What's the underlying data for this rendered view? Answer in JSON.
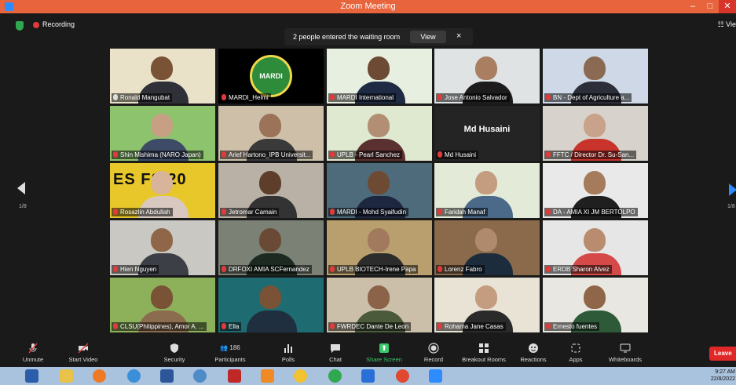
{
  "window": {
    "title": "Zoom Meeting"
  },
  "topbar": {
    "recording_label": "Recording",
    "view_label": "Vie"
  },
  "notification": {
    "text": "2 people entered the waiting room",
    "view_label": "View",
    "close_glyph": "×"
  },
  "pagination": {
    "left": "1/8",
    "right": "1/8"
  },
  "participants": [
    {
      "name": "Ronald Mangubat",
      "muted": false,
      "active": true,
      "tile_bg": "#e9e2c8",
      "skin": "#7a5236",
      "shirt": "#2f3038"
    },
    {
      "name": "MARDI_Helmi",
      "muted": true,
      "logo": "MARDI",
      "tile_bg": "#000000"
    },
    {
      "name": "MARDI International",
      "muted": true,
      "tile_bg": "#e6efe0",
      "skin": "#6d4a34",
      "shirt": "#1f2a44"
    },
    {
      "name": "Jose Antonio Salvador",
      "muted": true,
      "tile_bg": "#dfe3e4",
      "skin": "#a97e61",
      "shirt": "#1c1c1c"
    },
    {
      "name": "BN - Dept of Agriculture a...",
      "muted": true,
      "tile_bg": "#cfd8e6",
      "skin": "#8a6a53",
      "shirt": "#2c2f3a"
    },
    {
      "name": "Shin Mishima (NARO Japan)",
      "muted": true,
      "tile_bg": "#8dc36d",
      "skin": "#c7a084",
      "shirt": "#3d4b66"
    },
    {
      "name": "Arief Hartono_IPB Universit...",
      "muted": true,
      "tile_bg": "#cdbfa8",
      "skin": "#9b7358",
      "shirt": "#3a3a3a"
    },
    {
      "name": "UPLB - Pearl Sanchez",
      "muted": true,
      "tile_bg": "#dfe9cf",
      "skin": "#b28f74",
      "shirt": "#5a3030"
    },
    {
      "name": "Md Husaini",
      "muted": true,
      "name_only": "Md Husaini",
      "tile_bg": "#242424"
    },
    {
      "name": "FFTC / Director Dr. Su-San...",
      "muted": true,
      "tile_bg": "#d7d2cb",
      "skin": "#c8a28a",
      "shirt": "#c8342c"
    },
    {
      "name": "Rosazlin Abdullah",
      "muted": true,
      "banner": "ES FS 20",
      "tile_bg": "#e8c72a",
      "skin": "#d8b59a",
      "shirt": "#d8c8c0"
    },
    {
      "name": "Jetromar Camain",
      "muted": true,
      "tile_bg": "#b9b1a6",
      "skin": "#5d3e2a",
      "shirt": "#333333"
    },
    {
      "name": "MARDI - Mohd Syaifudin",
      "muted": true,
      "tile_bg": "#4e6b7c",
      "skin": "#6d4a34",
      "shirt": "#1d2740"
    },
    {
      "name": "Faridah Manaf",
      "muted": true,
      "tile_bg": "#e3ead8",
      "skin": "#c49c80",
      "shirt": "#4b6a8a"
    },
    {
      "name": "DA - AMIA XI JM BERTOLPO",
      "muted": true,
      "tile_bg": "#e9e9e9",
      "skin": "#a57b5c",
      "shirt": "#1f1f1f"
    },
    {
      "name": "Hien Nguyen",
      "muted": true,
      "tile_bg": "#c9c8c2",
      "skin": "#8f6648",
      "shirt": "#3d3f47"
    },
    {
      "name": "DRFOXI AMIA SCFernandez",
      "muted": true,
      "tile_bg": "#7b8275",
      "skin": "#6a4a35",
      "shirt": "#1d2a22"
    },
    {
      "name": "UPLB BIOTECH-Irene Papa",
      "muted": true,
      "tile_bg": "#b99f6e",
      "skin": "#a17a5e",
      "shirt": "#2c2c2c"
    },
    {
      "name": "Lorenz Fabro",
      "muted": true,
      "tile_bg": "#8a6a4a",
      "skin": "#b08a6c",
      "shirt": "#1c2c3c"
    },
    {
      "name": "ERDB Sharon Alvez",
      "muted": true,
      "tile_bg": "#e6e6e6",
      "skin": "#b98c6f",
      "shirt": "#d64949"
    },
    {
      "name": "CLSU(Philippines), Amor A. ...",
      "muted": true,
      "tile_bg": "#8db05a",
      "skin": "#7a5236",
      "shirt": "#8b6c4f"
    },
    {
      "name": "Ella",
      "muted": true,
      "tile_bg": "#1f6b72",
      "skin": "#7a5236",
      "shirt": "#1f2f3f"
    },
    {
      "name": "FWRDEC Dante De Leon",
      "muted": true,
      "tile_bg": "#cbbfa9",
      "skin": "#8a6348",
      "shirt": "#4b5a3a"
    },
    {
      "name": "Rohama Jane Casas",
      "muted": true,
      "tile_bg": "#e9e3d6",
      "skin": "#c49c80",
      "shirt": "#2a2a2a"
    },
    {
      "name": "Ernesto fuentes",
      "muted": true,
      "tile_bg": "#e9e7e1",
      "skin": "#8f6648",
      "shirt": "#2f5a3a"
    }
  ],
  "toolbar": {
    "unmute": "Unmute",
    "start_video": "Start Video",
    "security": "Security",
    "participants": "Participants",
    "participant_count": "186",
    "polls": "Polls",
    "chat": "Chat",
    "share_screen": "Share Screen",
    "record": "Record",
    "breakout_rooms": "Breakout Rooms",
    "reactions": "Reactions",
    "apps": "Apps",
    "whiteboards": "Whiteboards",
    "leave": "Leave"
  },
  "colors": {
    "accent": "#2d8cff",
    "share_green": "#39c86a",
    "leave_red": "#e02828",
    "titlebar": "#e7643d",
    "active_outline": "#c9e265"
  },
  "taskbar": {
    "time": "9:27 AM",
    "date": "22/8/2022"
  }
}
